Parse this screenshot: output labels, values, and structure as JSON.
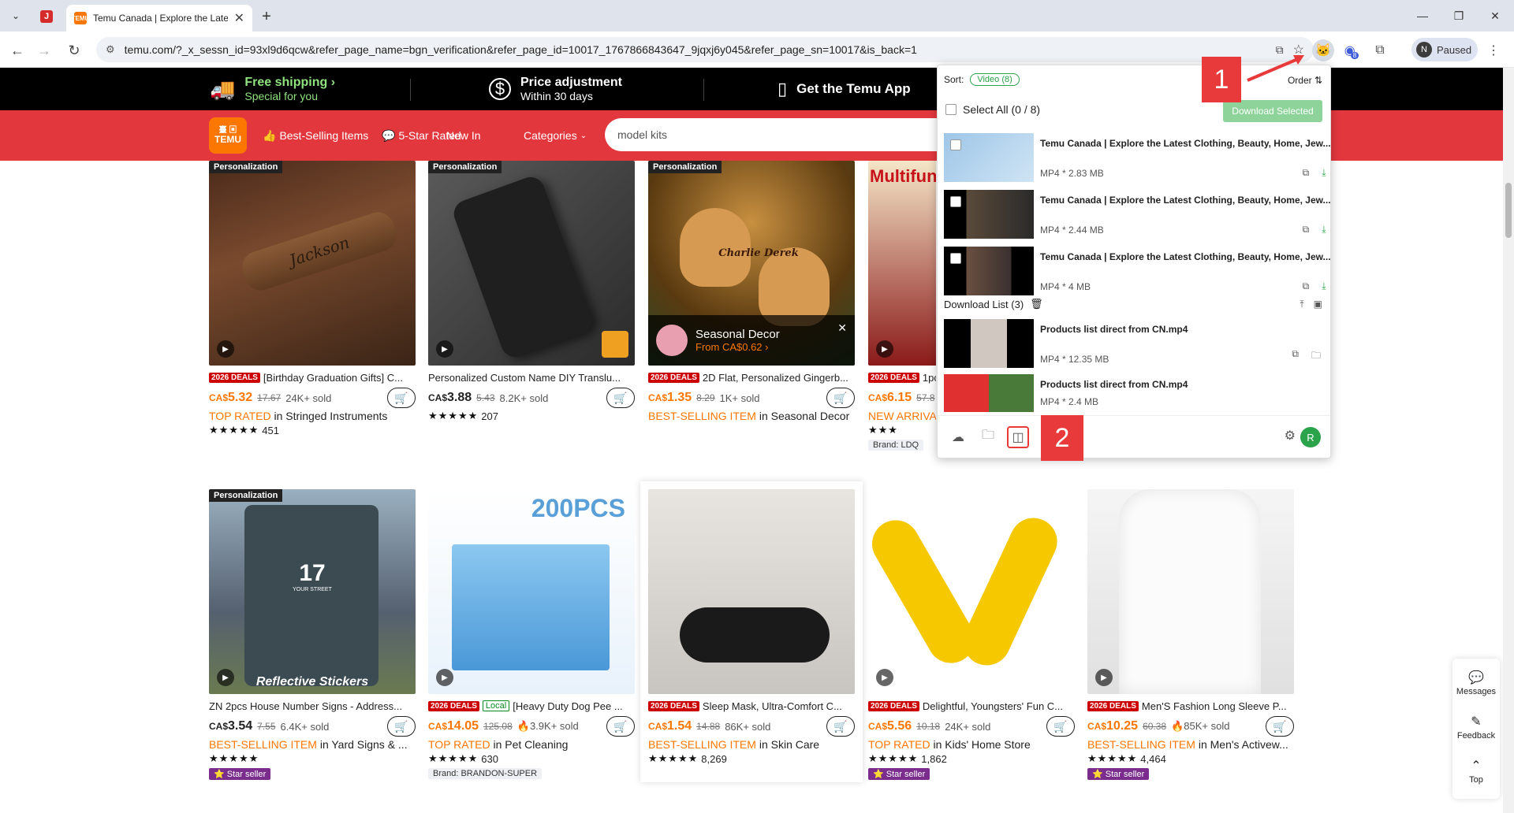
{
  "browser": {
    "tab_title": "Temu Canada | Explore the Latest",
    "url": "temu.com/?_x_sessn_id=93xl9d6qcw&refer_page_name=bgn_verification&refer_page_id=10017_1767866843647_9jqxj6y045&refer_page_sn=10017&is_back=1",
    "profile_initial": "N",
    "profile_status": "Paused",
    "ext_badge": "8"
  },
  "promo": {
    "shipping_title": "Free shipping ›",
    "shipping_sub": "Special for you",
    "price_title": "Price adjustment",
    "price_sub": "Within 30 days",
    "app_title": "Get the Temu App"
  },
  "nav": {
    "logo_top": "臺 ▣",
    "logo_bottom": "TEMU",
    "items": [
      "Best-Selling Items",
      "5-Star Rated",
      "New In",
      "Categories"
    ],
    "search_value": "model kits"
  },
  "products_row1": [
    {
      "pers": "Personalization",
      "deal": "2026 DEALS",
      "title": "[Birthday Graduation Gifts] C...",
      "currency": "CA$",
      "price": "5.32",
      "old": "17.67",
      "sold": "24K+ sold",
      "rank_label": "TOP RATED",
      "rank_text": "in Stringed Instruments",
      "stars": "★★★★★",
      "reviews": "451",
      "img_text": "Jackson"
    },
    {
      "pers": "Personalization",
      "deal": "",
      "title": "Personalized Custom Name DIY Translu...",
      "currency": "CA$",
      "price": "3.88",
      "old": "5.43",
      "sold": "8.2K+ sold",
      "rank_label": "",
      "rank_text": "",
      "stars": "★★★★★",
      "reviews": "207",
      "img_text": ""
    },
    {
      "pers": "Personalization",
      "deal": "2026 DEALS",
      "title": "2D Flat, Personalized Gingerb...",
      "currency": "CA$",
      "price": "1.35",
      "old": "8.29",
      "sold": "1K+ sold",
      "rank_label": "BEST-SELLING ITEM",
      "rank_text": "in Seasonal Decor",
      "stars": "",
      "reviews": "",
      "img_text": "Charlie  Derek",
      "popup_title": "Seasonal Decor",
      "popup_sub": "From CA$0.62 ›"
    },
    {
      "pers": "",
      "deal": "2026 DEALS",
      "title": "1pc",
      "currency": "CA$",
      "price": "6.15",
      "old": "57.8",
      "sold": "",
      "rank_label": "NEW ARRIVA",
      "rank_text": "",
      "stars": "★★★",
      "reviews": "",
      "img_text": "Multifun kitchen g",
      "brand": "Brand: LDQ"
    }
  ],
  "products_row2": [
    {
      "pers": "Personalization",
      "deal": "",
      "title": "ZN 2pcs House Number Signs - Address...",
      "currency": "CA$",
      "price": "3.54",
      "old": "7.55",
      "sold": "6.4K+ sold",
      "rank_label": "BEST-SELLING ITEM",
      "rank_text": "in Yard Signs & ...",
      "stars": "★★★★★",
      "reviews": "",
      "badge": "Star seller",
      "img_text": "Reflective Stickers",
      "img_num": "17",
      "img_street": "YOUR STREET"
    },
    {
      "pers": "",
      "deal": "2026 DEALS",
      "local": "Local",
      "title": "[Heavy Duty Dog Pee ...",
      "currency": "CA$",
      "price": "14.05",
      "old": "125.08",
      "sold": "🔥3.9K+ sold",
      "rank_label": "TOP RATED",
      "rank_text": "in Pet Cleaning",
      "stars": "★★★★★",
      "reviews": "630",
      "brand": "Brand: BRANDON-SUPER",
      "img_text": "200PCS"
    },
    {
      "pers": "",
      "deal": "2026 DEALS",
      "title": "Sleep Mask, Ultra-Comfort C...",
      "currency": "CA$",
      "price": "1.54",
      "old": "14.88",
      "sold": "86K+ sold",
      "rank_label": "BEST-SELLING ITEM",
      "rank_text": "in Skin Care",
      "stars": "★★★★★",
      "reviews": "8,269"
    },
    {
      "pers": "",
      "deal": "2026 DEALS",
      "title": "Delightful, Youngsters' Fun C...",
      "currency": "CA$",
      "price": "5.56",
      "old": "10.18",
      "sold": "24K+ sold",
      "rank_label": "TOP RATED",
      "rank_text": "in Kids' Home Store",
      "stars": "★★★★★",
      "reviews": "1,862",
      "badge": "Star seller"
    },
    {
      "pers": "",
      "deal": "2026 DEALS",
      "title": "Men'S Fashion Long Sleeve P...",
      "currency": "CA$",
      "price": "10.25",
      "old": "60.38",
      "sold": "🔥85K+ sold",
      "rank_label": "BEST-SELLING ITEM",
      "rank_text": "in Men's Activew...",
      "stars": "★★★★★",
      "reviews": "4,464",
      "badge": "Star seller"
    }
  ],
  "ext": {
    "sort_label": "Sort:",
    "chip": "Video (8)",
    "order": "Order ⇅",
    "select_all": "Select All (0 / 8)",
    "download_selected": "Download Selected",
    "videos": [
      {
        "title": "Temu Canada | Explore the Latest Clothing, Beauty, Home, Jew...",
        "meta": "MP4 * 2.83 MB"
      },
      {
        "title": "Temu Canada | Explore the Latest Clothing, Beauty, Home, Jew...",
        "meta": "MP4 * 2.44 MB"
      },
      {
        "title": "Temu Canada | Explore the Latest Clothing, Beauty, Home, Jew...",
        "meta": "MP4 * 4 MB"
      }
    ],
    "dl_head": "Download List (3)",
    "downloads": [
      {
        "title": "Products list direct from CN.mp4",
        "meta": "MP4 * 12.35 MB"
      },
      {
        "title": "Products list direct from CN.mp4",
        "meta": "MP4 * 2.4 MB"
      }
    ],
    "avatar": "R"
  },
  "callouts": {
    "one": "1",
    "two": "2"
  },
  "dock": {
    "messages": "Messages",
    "feedback": "Feedback",
    "top": "Top"
  },
  "colors": {
    "temu_orange": "#fb7701",
    "red_bar": "#e3373e",
    "ext_green": "#2aa34a",
    "callout_red": "#e83a3a"
  }
}
